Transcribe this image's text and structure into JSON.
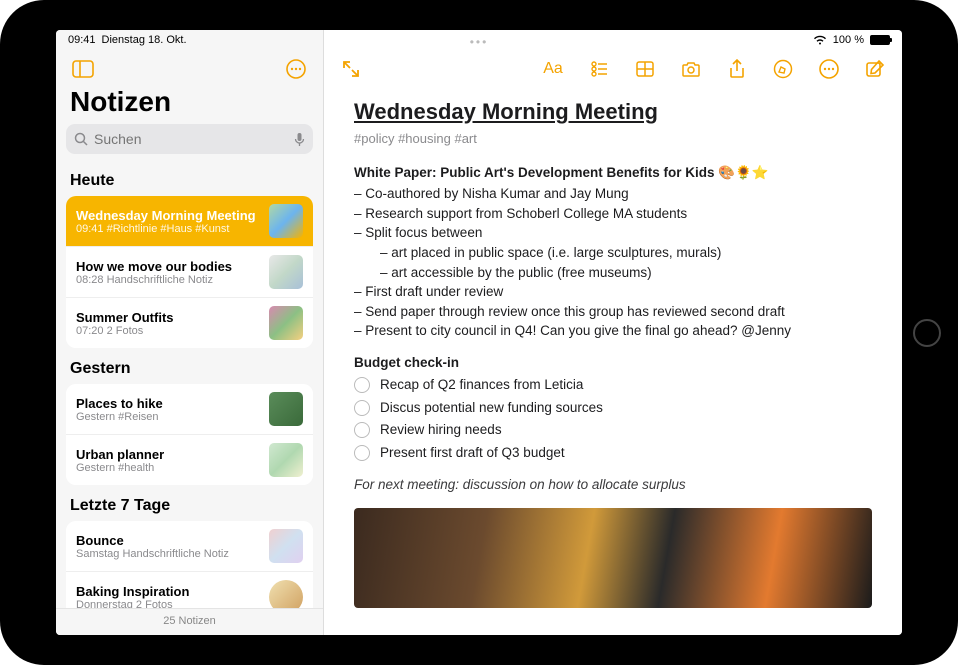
{
  "statusbar": {
    "time": "09:41",
    "date": "Dienstag 18. Okt.",
    "battery": "100 %",
    "wifi_icon": "wifi"
  },
  "sidebar": {
    "title": "Notizen",
    "search_placeholder": "Suchen",
    "footer": "25 Notizen",
    "sections": [
      {
        "header": "Heute",
        "items": [
          {
            "title": "Wednesday Morning Meeting",
            "sub": "09:41  #Richtlinie #Haus #Kunst",
            "selected": true
          },
          {
            "title": "How we move our bodies",
            "sub": "08:28  Handschriftliche Notiz",
            "selected": false
          },
          {
            "title": "Summer Outfits",
            "sub": "07:20  2 Fotos",
            "selected": false
          }
        ]
      },
      {
        "header": "Gestern",
        "items": [
          {
            "title": "Places to hike",
            "sub": "Gestern  #Reisen",
            "selected": false
          },
          {
            "title": "Urban planner",
            "sub": "Gestern  #health",
            "selected": false
          }
        ]
      },
      {
        "header": "Letzte 7 Tage",
        "items": [
          {
            "title": "Bounce",
            "sub": "Samstag  Handschriftliche Notiz",
            "selected": false
          },
          {
            "title": "Baking Inspiration",
            "sub": "Donnerstag  2 Fotos",
            "selected": false
          }
        ]
      }
    ]
  },
  "toolbar": {
    "format_label": "Aa"
  },
  "note": {
    "title": "Wednesday Morning Meeting",
    "tags": "#policy #housing #art",
    "section1_title": "White Paper: Public Art's Development Benefits for Kids 🎨🌻⭐",
    "lines": [
      "– Co-authored by Nisha Kumar and Jay Mung",
      "– Research support from Schoberl College MA students",
      "– Split focus between",
      "– art placed in public space (i.e. large sculptures, murals)",
      "– art accessible by the public (free museums)",
      "– First draft under review",
      "– Send paper through review once this group has reviewed second draft",
      "– Present to city council in Q4! Can you give the final go ahead? @Jenny"
    ],
    "section2_title": "Budget check-in",
    "checklist": [
      "Recap of Q2 finances from Leticia",
      "Discus potential new funding sources",
      "Review hiring needs",
      "Present first draft of Q3 budget"
    ],
    "footer_line": "For next meeting: discussion on how to allocate surplus"
  }
}
